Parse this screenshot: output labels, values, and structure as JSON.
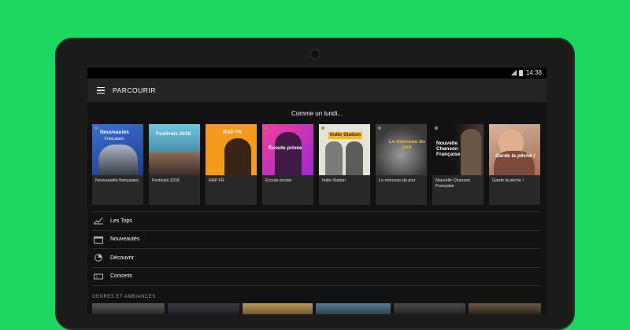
{
  "status_bar": {
    "time": "14:38"
  },
  "app_bar": {
    "title": "PARCOURIR"
  },
  "featured": {
    "title": "Comme un lundi...",
    "playlists": [
      {
        "cover_title": "Nouveautés",
        "cover_subtitle": "Françaises",
        "label": "Nouveautés françaises"
      },
      {
        "cover_title": "Festivals 2016",
        "label": "Festivals 2016"
      },
      {
        "cover_title": "RAP FR",
        "label": "RAP FR"
      },
      {
        "cover_title": "Écoute privée",
        "label": "Écoute privée"
      },
      {
        "cover_title": "Indie Station",
        "label": "Indie Station"
      },
      {
        "cover_title": "Le morceau du jour",
        "label": "Le morceau du jour"
      },
      {
        "cover_title": "Nouvelle Chanson Française",
        "label": "Nouvelle Chanson Française"
      },
      {
        "cover_title": "Garde la pêche !",
        "label": "Garde la pêche !"
      }
    ]
  },
  "menu": [
    {
      "label": "Les Tops",
      "icon": "chart-line-icon"
    },
    {
      "label": "Nouveautés",
      "icon": "calendar-icon"
    },
    {
      "label": "Découvrir",
      "icon": "compass-icon"
    },
    {
      "label": "Concerts",
      "icon": "ticket-icon"
    }
  ],
  "genres": {
    "title": "GENRES ET AMBIANCES"
  },
  "colors": {
    "brand_green": "#1ed760",
    "background": "#121212",
    "card": "#282828"
  }
}
